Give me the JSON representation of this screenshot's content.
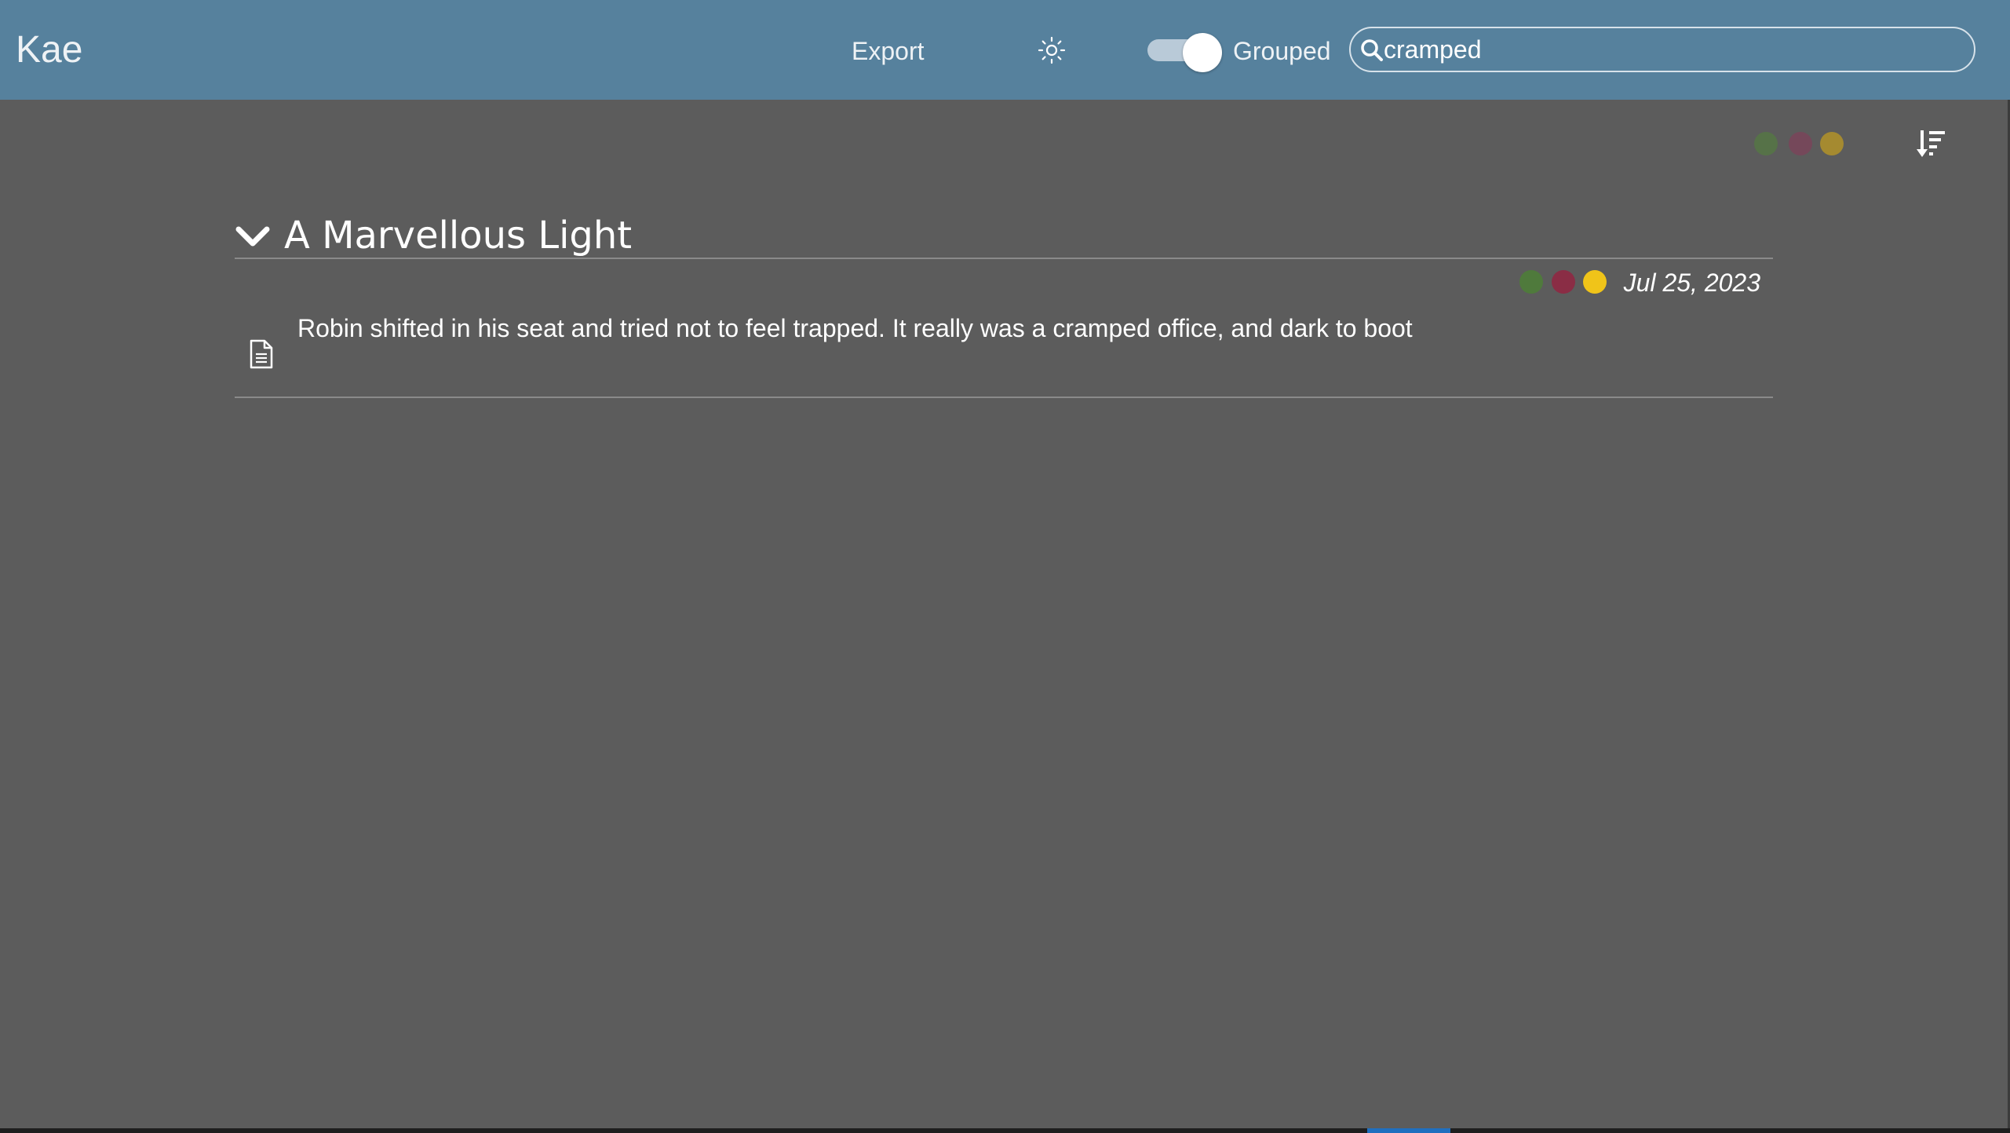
{
  "header": {
    "brand": "Kae",
    "export_label": "Export",
    "theme_icon": "sun-icon",
    "grouped_label": "Grouped",
    "grouped_on": true,
    "search": {
      "value": "cramped",
      "icon": "search-icon"
    }
  },
  "colors": {
    "header_bg": "#56819d",
    "page_bg": "#5c5c5c",
    "green": "#4f7a3c",
    "red": "#8a2d45",
    "yellow": "#f0c419",
    "green_dim": "#567248",
    "red_dim": "#75485a",
    "yellow_dim": "#a58a30"
  },
  "toolbar": {
    "filter_dots": [
      "green",
      "red",
      "yellow"
    ],
    "sort_icon": "sort-descending-icon"
  },
  "group": {
    "title": "A Marvellous Light",
    "expanded": true,
    "entries": [
      {
        "date": "Jul 25, 2023",
        "dots": [
          "green",
          "red",
          "yellow"
        ],
        "text": "Robin shifted in his seat and tried not to feel trapped. It really was a cramped office, and dark to boot",
        "icon": "document-icon"
      }
    ]
  }
}
